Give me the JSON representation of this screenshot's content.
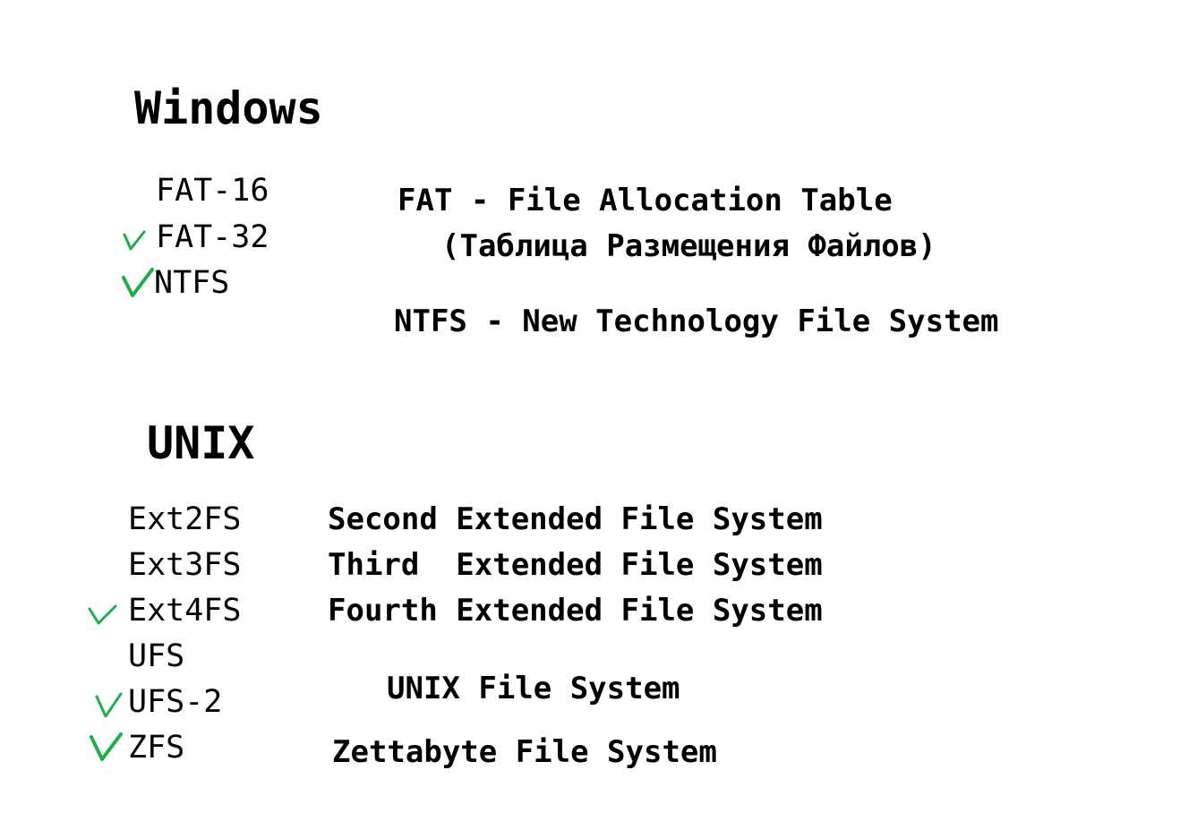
{
  "windows": {
    "heading": "Windows",
    "items": [
      "FAT-16",
      "FAT-32",
      "NTFS"
    ],
    "descriptions": [
      "FAT - File Allocation Table",
      "(Таблица Размещения Файлов)",
      "NTFS - New Technology File System"
    ]
  },
  "unix": {
    "heading": "UNIX",
    "items": [
      "Ext2FS",
      "Ext3FS",
      "Ext4FS",
      "UFS",
      "UFS-2",
      "ZFS"
    ],
    "descriptions": [
      "Second Extended File System",
      "Third  Extended File System",
      "Fourth Extended File System",
      "UNIX File System",
      "Zettabyte File System"
    ]
  },
  "colors": {
    "checkmark": "#1fae4a",
    "text": "#000000",
    "background": "#ffffff"
  },
  "icons": {
    "checkmark": "check-icon"
  }
}
